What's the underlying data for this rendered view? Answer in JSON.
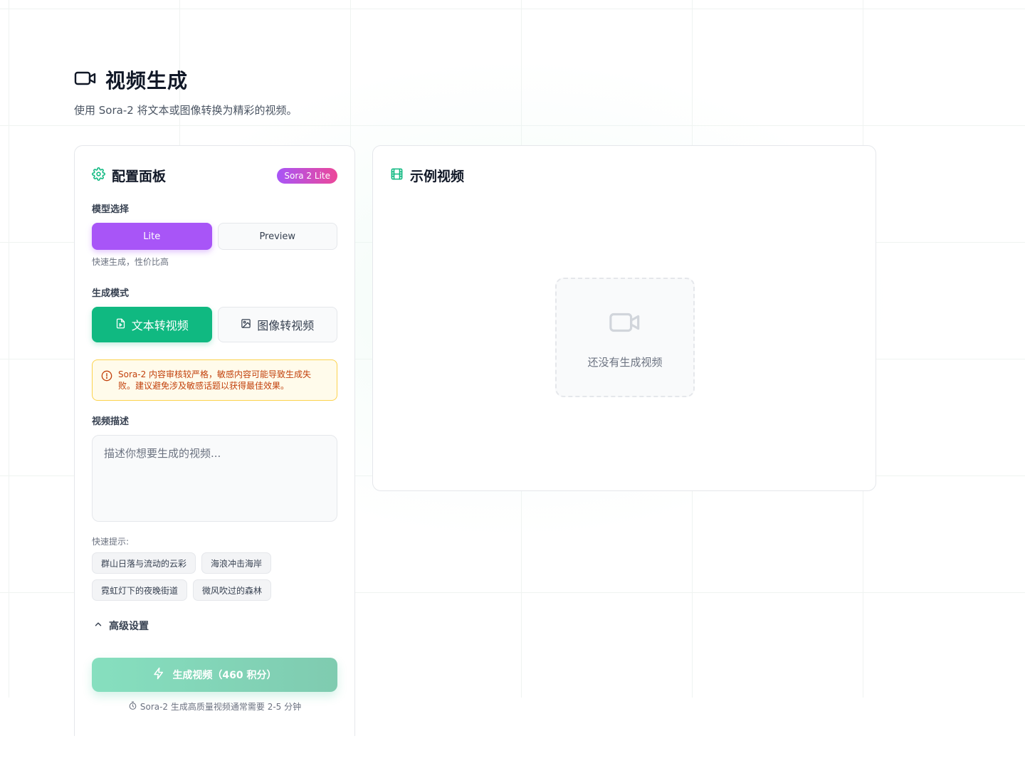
{
  "header": {
    "title": "视频生成",
    "subtitle": "使用 Sora-2 将文本或图像转换为精彩的视频。"
  },
  "config": {
    "title": "配置面板",
    "badge": "Sora 2 Lite",
    "model_label": "模型选择",
    "model_options": [
      "Lite",
      "Preview"
    ],
    "model_selected": "Lite",
    "model_hint": "快速生成，性价比高",
    "mode_label": "生成模式",
    "mode_options": [
      "文本转视频",
      "图像转视频"
    ],
    "mode_selected": "文本转视频",
    "warning": "Sora-2 内容审核较严格，敏感内容可能导致生成失败。建议避免涉及敏感话题以获得最佳效果。",
    "desc_label": "视频描述",
    "desc_placeholder": "描述你想要生成的视频...",
    "quick_label": "快速提示:",
    "quick_chips": [
      "群山日落与流动的云彩",
      "海浪冲击海岸",
      "霓虹灯下的夜晚街道",
      "微风吹过的森林"
    ],
    "advanced_label": "高级设置",
    "generate_label": "生成视频（460 积分）",
    "footnote": "Sora-2 生成高质量视频通常需要 2-5 分钟"
  },
  "preview": {
    "title": "示例视频",
    "empty_text": "还没有生成视频"
  },
  "colors": {
    "accent_green": "#10b981",
    "accent_purple": "#a855f7",
    "badge_pink": "#ec4899",
    "warning_text": "#c2410c"
  },
  "icons": {
    "title": "video-camera-icon",
    "config": "gear-icon",
    "preview": "film-icon"
  }
}
